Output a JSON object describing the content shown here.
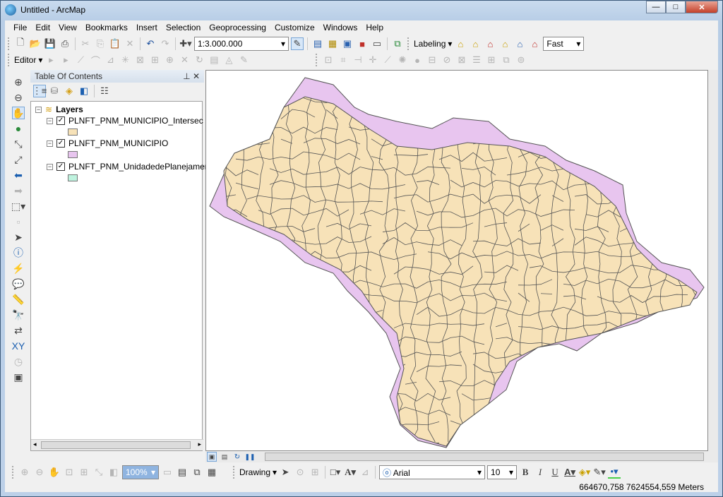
{
  "window": {
    "title": "Untitled - ArcMap",
    "minimize": "—",
    "maximize": "□",
    "close": "✕"
  },
  "menu": [
    "File",
    "Edit",
    "View",
    "Bookmarks",
    "Insert",
    "Selection",
    "Geoprocessing",
    "Customize",
    "Windows",
    "Help"
  ],
  "standard_toolbar": {
    "scale": "1:3.000.000"
  },
  "labeling_toolbar": {
    "label": "Labeling",
    "quality": "Fast"
  },
  "editor_toolbar": {
    "label": "Editor"
  },
  "toc": {
    "title": "Table Of Contents",
    "root": "Layers",
    "layers": [
      {
        "name": "PLNFT_PNM_MUNICIPIO_Intersec",
        "color": "#f7e2b8",
        "checked": true
      },
      {
        "name": "PLNFT_PNM_MUNICIPIO",
        "color": "#e8c5ef",
        "checked": true
      },
      {
        "name": "PLNFT_PNM_UnidadedePlanejamento",
        "color": "#bff3df",
        "checked": true
      }
    ]
  },
  "drawing_toolbar": {
    "label": "Drawing",
    "font": "Arial",
    "size": "10",
    "zoom": "100%"
  },
  "status": {
    "coordinates": "664670,758  7624554,559 Meters"
  },
  "colors": {
    "intersec_fill": "#f7e2b8",
    "municipio_fill": "#e8c5ef",
    "boundary": "#555555"
  }
}
